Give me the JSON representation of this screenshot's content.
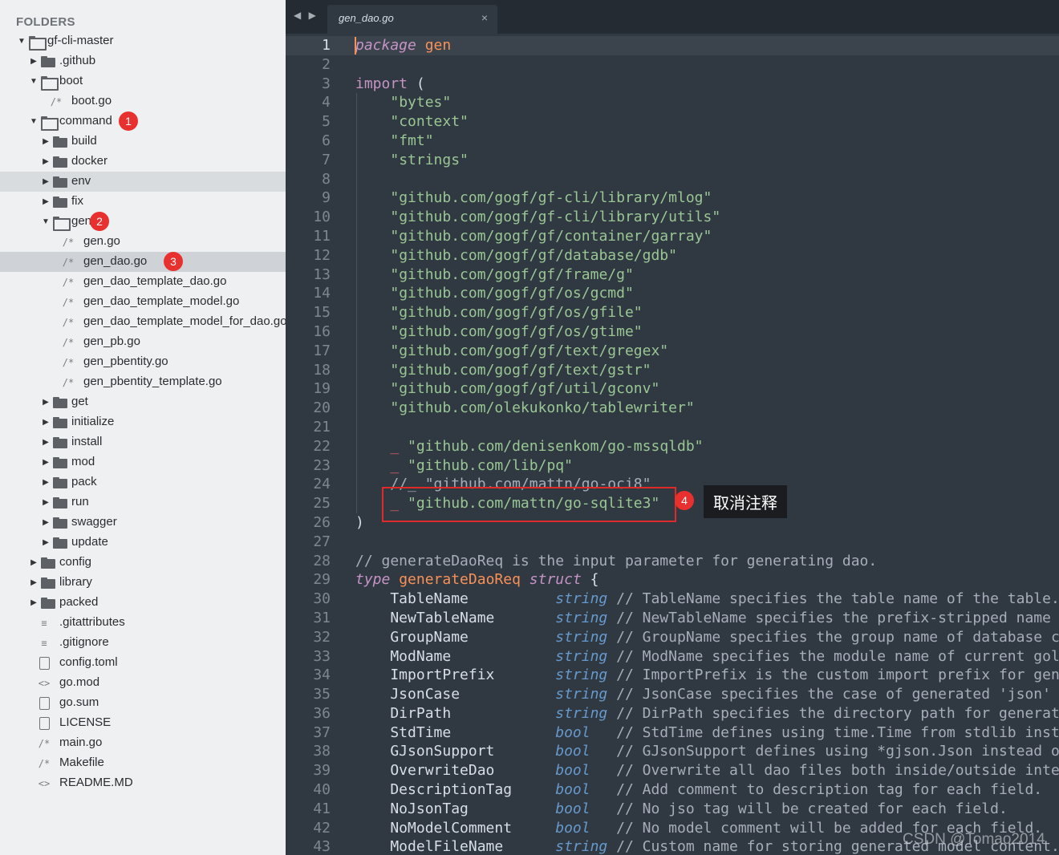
{
  "sidebar": {
    "header": "FOLDERS",
    "items": [
      {
        "label": "gf-cli-master",
        "kind": "folder",
        "depth": 0,
        "expanded": true,
        "icon": "folder-open-icon"
      },
      {
        "label": ".github",
        "kind": "folder",
        "depth": 1,
        "expanded": false,
        "icon": "folder-icon"
      },
      {
        "label": "boot",
        "kind": "folder",
        "depth": 1,
        "expanded": true,
        "icon": "folder-open-icon"
      },
      {
        "label": "boot.go",
        "kind": "file",
        "depth": 2,
        "glyph": "/*",
        "icon": "comment-file-icon"
      },
      {
        "label": "command",
        "kind": "folder",
        "depth": 1,
        "expanded": true,
        "icon": "folder-open-icon",
        "badge": "1"
      },
      {
        "label": "build",
        "kind": "folder",
        "depth": 2,
        "expanded": false,
        "icon": "folder-icon"
      },
      {
        "label": "docker",
        "kind": "folder",
        "depth": 2,
        "expanded": false,
        "icon": "folder-icon"
      },
      {
        "label": "env",
        "kind": "folder",
        "depth": 2,
        "expanded": false,
        "icon": "folder-icon",
        "hover": true
      },
      {
        "label": "fix",
        "kind": "folder",
        "depth": 2,
        "expanded": false,
        "icon": "folder-icon"
      },
      {
        "label": "gen",
        "kind": "folder",
        "depth": 2,
        "expanded": true,
        "icon": "folder-open-icon",
        "badge": "2"
      },
      {
        "label": "gen.go",
        "kind": "file",
        "depth": 3,
        "glyph": "/*",
        "icon": "comment-file-icon"
      },
      {
        "label": "gen_dao.go",
        "kind": "file",
        "depth": 3,
        "glyph": "/*",
        "icon": "comment-file-icon",
        "selected": true,
        "badge": "3"
      },
      {
        "label": "gen_dao_template_dao.go",
        "kind": "file",
        "depth": 3,
        "glyph": "/*",
        "icon": "comment-file-icon"
      },
      {
        "label": "gen_dao_template_model.go",
        "kind": "file",
        "depth": 3,
        "glyph": "/*",
        "icon": "comment-file-icon"
      },
      {
        "label": "gen_dao_template_model_for_dao.go",
        "kind": "file",
        "depth": 3,
        "glyph": "/*",
        "icon": "comment-file-icon"
      },
      {
        "label": "gen_pb.go",
        "kind": "file",
        "depth": 3,
        "glyph": "/*",
        "icon": "comment-file-icon"
      },
      {
        "label": "gen_pbentity.go",
        "kind": "file",
        "depth": 3,
        "glyph": "/*",
        "icon": "comment-file-icon"
      },
      {
        "label": "gen_pbentity_template.go",
        "kind": "file",
        "depth": 3,
        "glyph": "/*",
        "icon": "comment-file-icon"
      },
      {
        "label": "get",
        "kind": "folder",
        "depth": 2,
        "expanded": false,
        "icon": "folder-icon"
      },
      {
        "label": "initialize",
        "kind": "folder",
        "depth": 2,
        "expanded": false,
        "icon": "folder-icon"
      },
      {
        "label": "install",
        "kind": "folder",
        "depth": 2,
        "expanded": false,
        "icon": "folder-icon"
      },
      {
        "label": "mod",
        "kind": "folder",
        "depth": 2,
        "expanded": false,
        "icon": "folder-icon"
      },
      {
        "label": "pack",
        "kind": "folder",
        "depth": 2,
        "expanded": false,
        "icon": "folder-icon"
      },
      {
        "label": "run",
        "kind": "folder",
        "depth": 2,
        "expanded": false,
        "icon": "folder-icon"
      },
      {
        "label": "swagger",
        "kind": "folder",
        "depth": 2,
        "expanded": false,
        "icon": "folder-icon"
      },
      {
        "label": "update",
        "kind": "folder",
        "depth": 2,
        "expanded": false,
        "icon": "folder-icon"
      },
      {
        "label": "config",
        "kind": "folder",
        "depth": 1,
        "expanded": false,
        "icon": "folder-icon"
      },
      {
        "label": "library",
        "kind": "folder",
        "depth": 1,
        "expanded": false,
        "icon": "folder-icon"
      },
      {
        "label": "packed",
        "kind": "folder",
        "depth": 1,
        "expanded": false,
        "icon": "folder-icon"
      },
      {
        "label": ".gitattributes",
        "kind": "file",
        "depth": 1,
        "glyph": "≡",
        "icon": "list-file-icon"
      },
      {
        "label": ".gitignore",
        "kind": "file",
        "depth": 1,
        "glyph": "≡",
        "icon": "list-file-icon"
      },
      {
        "label": "config.toml",
        "kind": "file",
        "depth": 1,
        "glyph": "",
        "icon": "file-icon"
      },
      {
        "label": "go.mod",
        "kind": "file",
        "depth": 1,
        "glyph": "<>",
        "icon": "code-file-icon"
      },
      {
        "label": "go.sum",
        "kind": "file",
        "depth": 1,
        "glyph": "",
        "icon": "file-icon"
      },
      {
        "label": "LICENSE",
        "kind": "file",
        "depth": 1,
        "glyph": "",
        "icon": "file-icon"
      },
      {
        "label": "main.go",
        "kind": "file",
        "depth": 1,
        "glyph": "/*",
        "icon": "comment-file-icon"
      },
      {
        "label": "Makefile",
        "kind": "file",
        "depth": 1,
        "glyph": "/*",
        "icon": "comment-file-icon"
      },
      {
        "label": "README.MD",
        "kind": "file",
        "depth": 1,
        "glyph": "<>",
        "icon": "code-file-icon"
      }
    ]
  },
  "editor": {
    "nav_arrows": "◀ ▶",
    "tab_title": "gen_dao.go",
    "tab_close": "×",
    "current_line": 1,
    "lines": [
      [
        [
          "kw",
          "package"
        ],
        [
          "t",
          " "
        ],
        [
          "nm",
          "gen"
        ]
      ],
      [],
      [
        [
          "kwi",
          "import"
        ],
        [
          "t",
          " ("
        ]
      ],
      [
        [
          "t",
          "    "
        ],
        [
          "str",
          "\"bytes\""
        ]
      ],
      [
        [
          "t",
          "    "
        ],
        [
          "str",
          "\"context\""
        ]
      ],
      [
        [
          "t",
          "    "
        ],
        [
          "str",
          "\"fmt\""
        ]
      ],
      [
        [
          "t",
          "    "
        ],
        [
          "str",
          "\"strings\""
        ]
      ],
      [],
      [
        [
          "t",
          "    "
        ],
        [
          "str",
          "\"github.com/gogf/gf-cli/library/mlog\""
        ]
      ],
      [
        [
          "t",
          "    "
        ],
        [
          "str",
          "\"github.com/gogf/gf-cli/library/utils\""
        ]
      ],
      [
        [
          "t",
          "    "
        ],
        [
          "str",
          "\"github.com/gogf/gf/container/garray\""
        ]
      ],
      [
        [
          "t",
          "    "
        ],
        [
          "str",
          "\"github.com/gogf/gf/database/gdb\""
        ]
      ],
      [
        [
          "t",
          "    "
        ],
        [
          "str",
          "\"github.com/gogf/gf/frame/g\""
        ]
      ],
      [
        [
          "t",
          "    "
        ],
        [
          "str",
          "\"github.com/gogf/gf/os/gcmd\""
        ]
      ],
      [
        [
          "t",
          "    "
        ],
        [
          "str",
          "\"github.com/gogf/gf/os/gfile\""
        ]
      ],
      [
        [
          "t",
          "    "
        ],
        [
          "str",
          "\"github.com/gogf/gf/os/gtime\""
        ]
      ],
      [
        [
          "t",
          "    "
        ],
        [
          "str",
          "\"github.com/gogf/gf/text/gregex\""
        ]
      ],
      [
        [
          "t",
          "    "
        ],
        [
          "str",
          "\"github.com/gogf/gf/text/gstr\""
        ]
      ],
      [
        [
          "t",
          "    "
        ],
        [
          "str",
          "\"github.com/gogf/gf/util/gconv\""
        ]
      ],
      [
        [
          "t",
          "    "
        ],
        [
          "str",
          "\"github.com/olekukonko/tablewriter\""
        ]
      ],
      [],
      [
        [
          "t",
          "    "
        ],
        [
          "und",
          "_"
        ],
        [
          "t",
          " "
        ],
        [
          "str",
          "\"github.com/denisenkom/go-mssqldb\""
        ]
      ],
      [
        [
          "t",
          "    "
        ],
        [
          "und",
          "_"
        ],
        [
          "t",
          " "
        ],
        [
          "str",
          "\"github.com/lib/pq\""
        ]
      ],
      [
        [
          "t",
          "    "
        ],
        [
          "cmt",
          "//_ \"github.com/mattn/go-oci8\""
        ]
      ],
      [
        [
          "t",
          "    "
        ],
        [
          "und",
          "_"
        ],
        [
          "t",
          " "
        ],
        [
          "str",
          "\"github.com/mattn/go-sqlite3\""
        ]
      ],
      [
        [
          "t",
          ")"
        ]
      ],
      [],
      [
        [
          "cmt",
          "// generateDaoReq is the input parameter for generating dao."
        ]
      ],
      [
        [
          "kw",
          "type"
        ],
        [
          "t",
          " "
        ],
        [
          "nm",
          "generateDaoReq"
        ],
        [
          "t",
          " "
        ],
        [
          "kw",
          "struct"
        ],
        [
          "t",
          " {"
        ]
      ],
      [
        [
          "t",
          "    TableName          "
        ],
        [
          "typ",
          "string"
        ],
        [
          "cmt",
          " // TableName specifies the table name of the table."
        ]
      ],
      [
        [
          "t",
          "    NewTableName       "
        ],
        [
          "typ",
          "string"
        ],
        [
          "cmt",
          " // NewTableName specifies the prefix-stripped name of the table."
        ]
      ],
      [
        [
          "t",
          "    GroupName          "
        ],
        [
          "typ",
          "string"
        ],
        [
          "cmt",
          " // GroupName specifies the group name of database configuration node."
        ]
      ],
      [
        [
          "t",
          "    ModName            "
        ],
        [
          "typ",
          "string"
        ],
        [
          "cmt",
          " // ModName specifies the module name of current golang project."
        ]
      ],
      [
        [
          "t",
          "    ImportPrefix       "
        ],
        [
          "typ",
          "string"
        ],
        [
          "cmt",
          " // ImportPrefix is the custom import prefix for generated go files."
        ]
      ],
      [
        [
          "t",
          "    JsonCase           "
        ],
        [
          "typ",
          "string"
        ],
        [
          "cmt",
          " // JsonCase specifies the case of generated 'json' tag."
        ]
      ],
      [
        [
          "t",
          "    DirPath            "
        ],
        [
          "typ",
          "string"
        ],
        [
          "cmt",
          " // DirPath specifies the directory path for generated files."
        ]
      ],
      [
        [
          "t",
          "    StdTime            "
        ],
        [
          "typ",
          "bool"
        ],
        [
          "cmt",
          "   // StdTime defines using time.Time from stdlib instead of gtime.Time."
        ]
      ],
      [
        [
          "t",
          "    GJsonSupport       "
        ],
        [
          "typ",
          "bool"
        ],
        [
          "cmt",
          "   // GJsonSupport defines using *gjson.Json instead of string."
        ]
      ],
      [
        [
          "t",
          "    OverwriteDao       "
        ],
        [
          "typ",
          "bool"
        ],
        [
          "cmt",
          "   // Overwrite all dao files both inside/outside internal folder."
        ]
      ],
      [
        [
          "t",
          "    DescriptionTag     "
        ],
        [
          "typ",
          "bool"
        ],
        [
          "cmt",
          "   // Add comment to description tag for each field."
        ]
      ],
      [
        [
          "t",
          "    NoJsonTag          "
        ],
        [
          "typ",
          "bool"
        ],
        [
          "cmt",
          "   // No jso tag will be created for each field."
        ]
      ],
      [
        [
          "t",
          "    NoModelComment     "
        ],
        [
          "typ",
          "bool"
        ],
        [
          "cmt",
          "   // No model comment will be added for each field."
        ]
      ],
      [
        [
          "t",
          "    ModelFileName      "
        ],
        [
          "typ",
          "string"
        ],
        [
          "cmt",
          " // Custom name for storing generated model content."
        ]
      ]
    ]
  },
  "annotation": {
    "badge": "4",
    "tooltip": "取消注释",
    "highlight_color": "#e02a2a"
  },
  "watermark": "CSDN @Tomao2014"
}
